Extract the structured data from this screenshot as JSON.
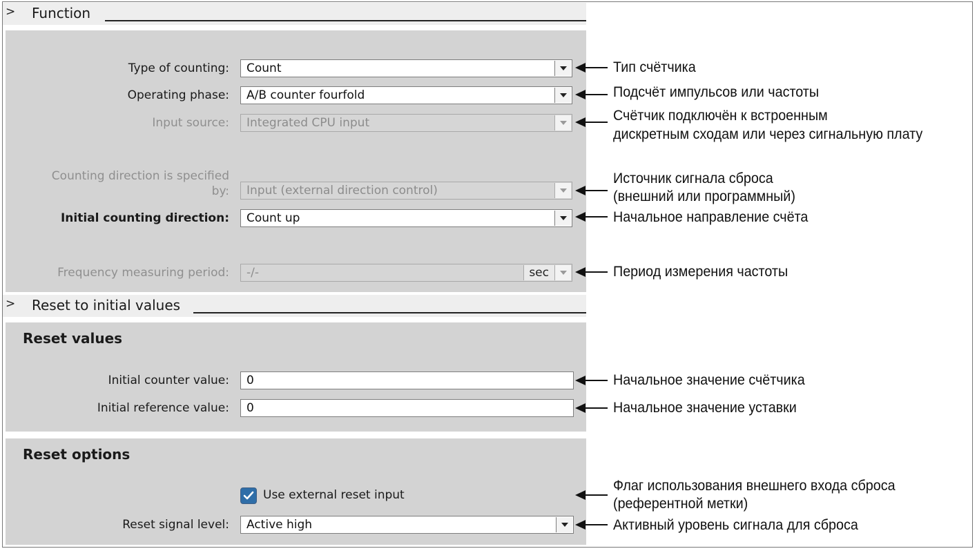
{
  "function_section": {
    "title": "Function",
    "type_of_counting": {
      "label": "Type of counting:",
      "value": "Count"
    },
    "operating_phase": {
      "label": "Operating phase:",
      "value": "A/B counter fourfold"
    },
    "input_source": {
      "label": "Input source:",
      "value": "Integrated CPU input"
    },
    "counting_direction": {
      "label_line1": "Counting direction is specified",
      "label_line2": "by:",
      "value": "Input (external direction control)"
    },
    "initial_direction": {
      "label": "Initial counting direction:",
      "value": "Count up"
    },
    "frequency_period": {
      "label": "Frequency measuring period:",
      "value": "-/-",
      "unit": "sec"
    }
  },
  "reset_section": {
    "title": "Reset to initial values",
    "reset_values_heading": "Reset values",
    "initial_counter": {
      "label": "Initial counter value:",
      "value": "0"
    },
    "initial_reference": {
      "label": "Initial reference value:",
      "value": "0"
    },
    "reset_options_heading": "Reset options",
    "use_external_reset": {
      "label": "Use external reset input",
      "checked": true
    },
    "reset_signal_level": {
      "label": "Reset signal level:",
      "value": "Active high"
    }
  },
  "annotations": {
    "type_of_counting": "Тип счётчика",
    "operating_phase": "Подсчёт импульсов или частоты",
    "input_source_line1": "Счётчик подключён к встроенным",
    "input_source_line2": "дискретным сходам или через сигнальную плату",
    "direction_line1": "Источник сигнала сброса",
    "direction_line2": "(внешний или программный)",
    "initial_direction": "Начальное направление счёта",
    "frequency_period": "Период измерения частоты",
    "initial_counter": "Начальное значение счётчика",
    "initial_reference": "Начальное значение уставки",
    "external_reset_line1": "Флаг использования внешнего входа сброса",
    "external_reset_line2": "(референтной метки)",
    "signal_level": "Активный уровень сигнала для сброса"
  },
  "colors": {
    "panel": "#d3d3d3",
    "header": "#eeeeee",
    "checkbox": "#2f6ea8"
  },
  "icons": [
    "chevron-right-icon",
    "dropdown-arrow-icon",
    "checkmark-icon",
    "arrow-left-icon"
  ]
}
